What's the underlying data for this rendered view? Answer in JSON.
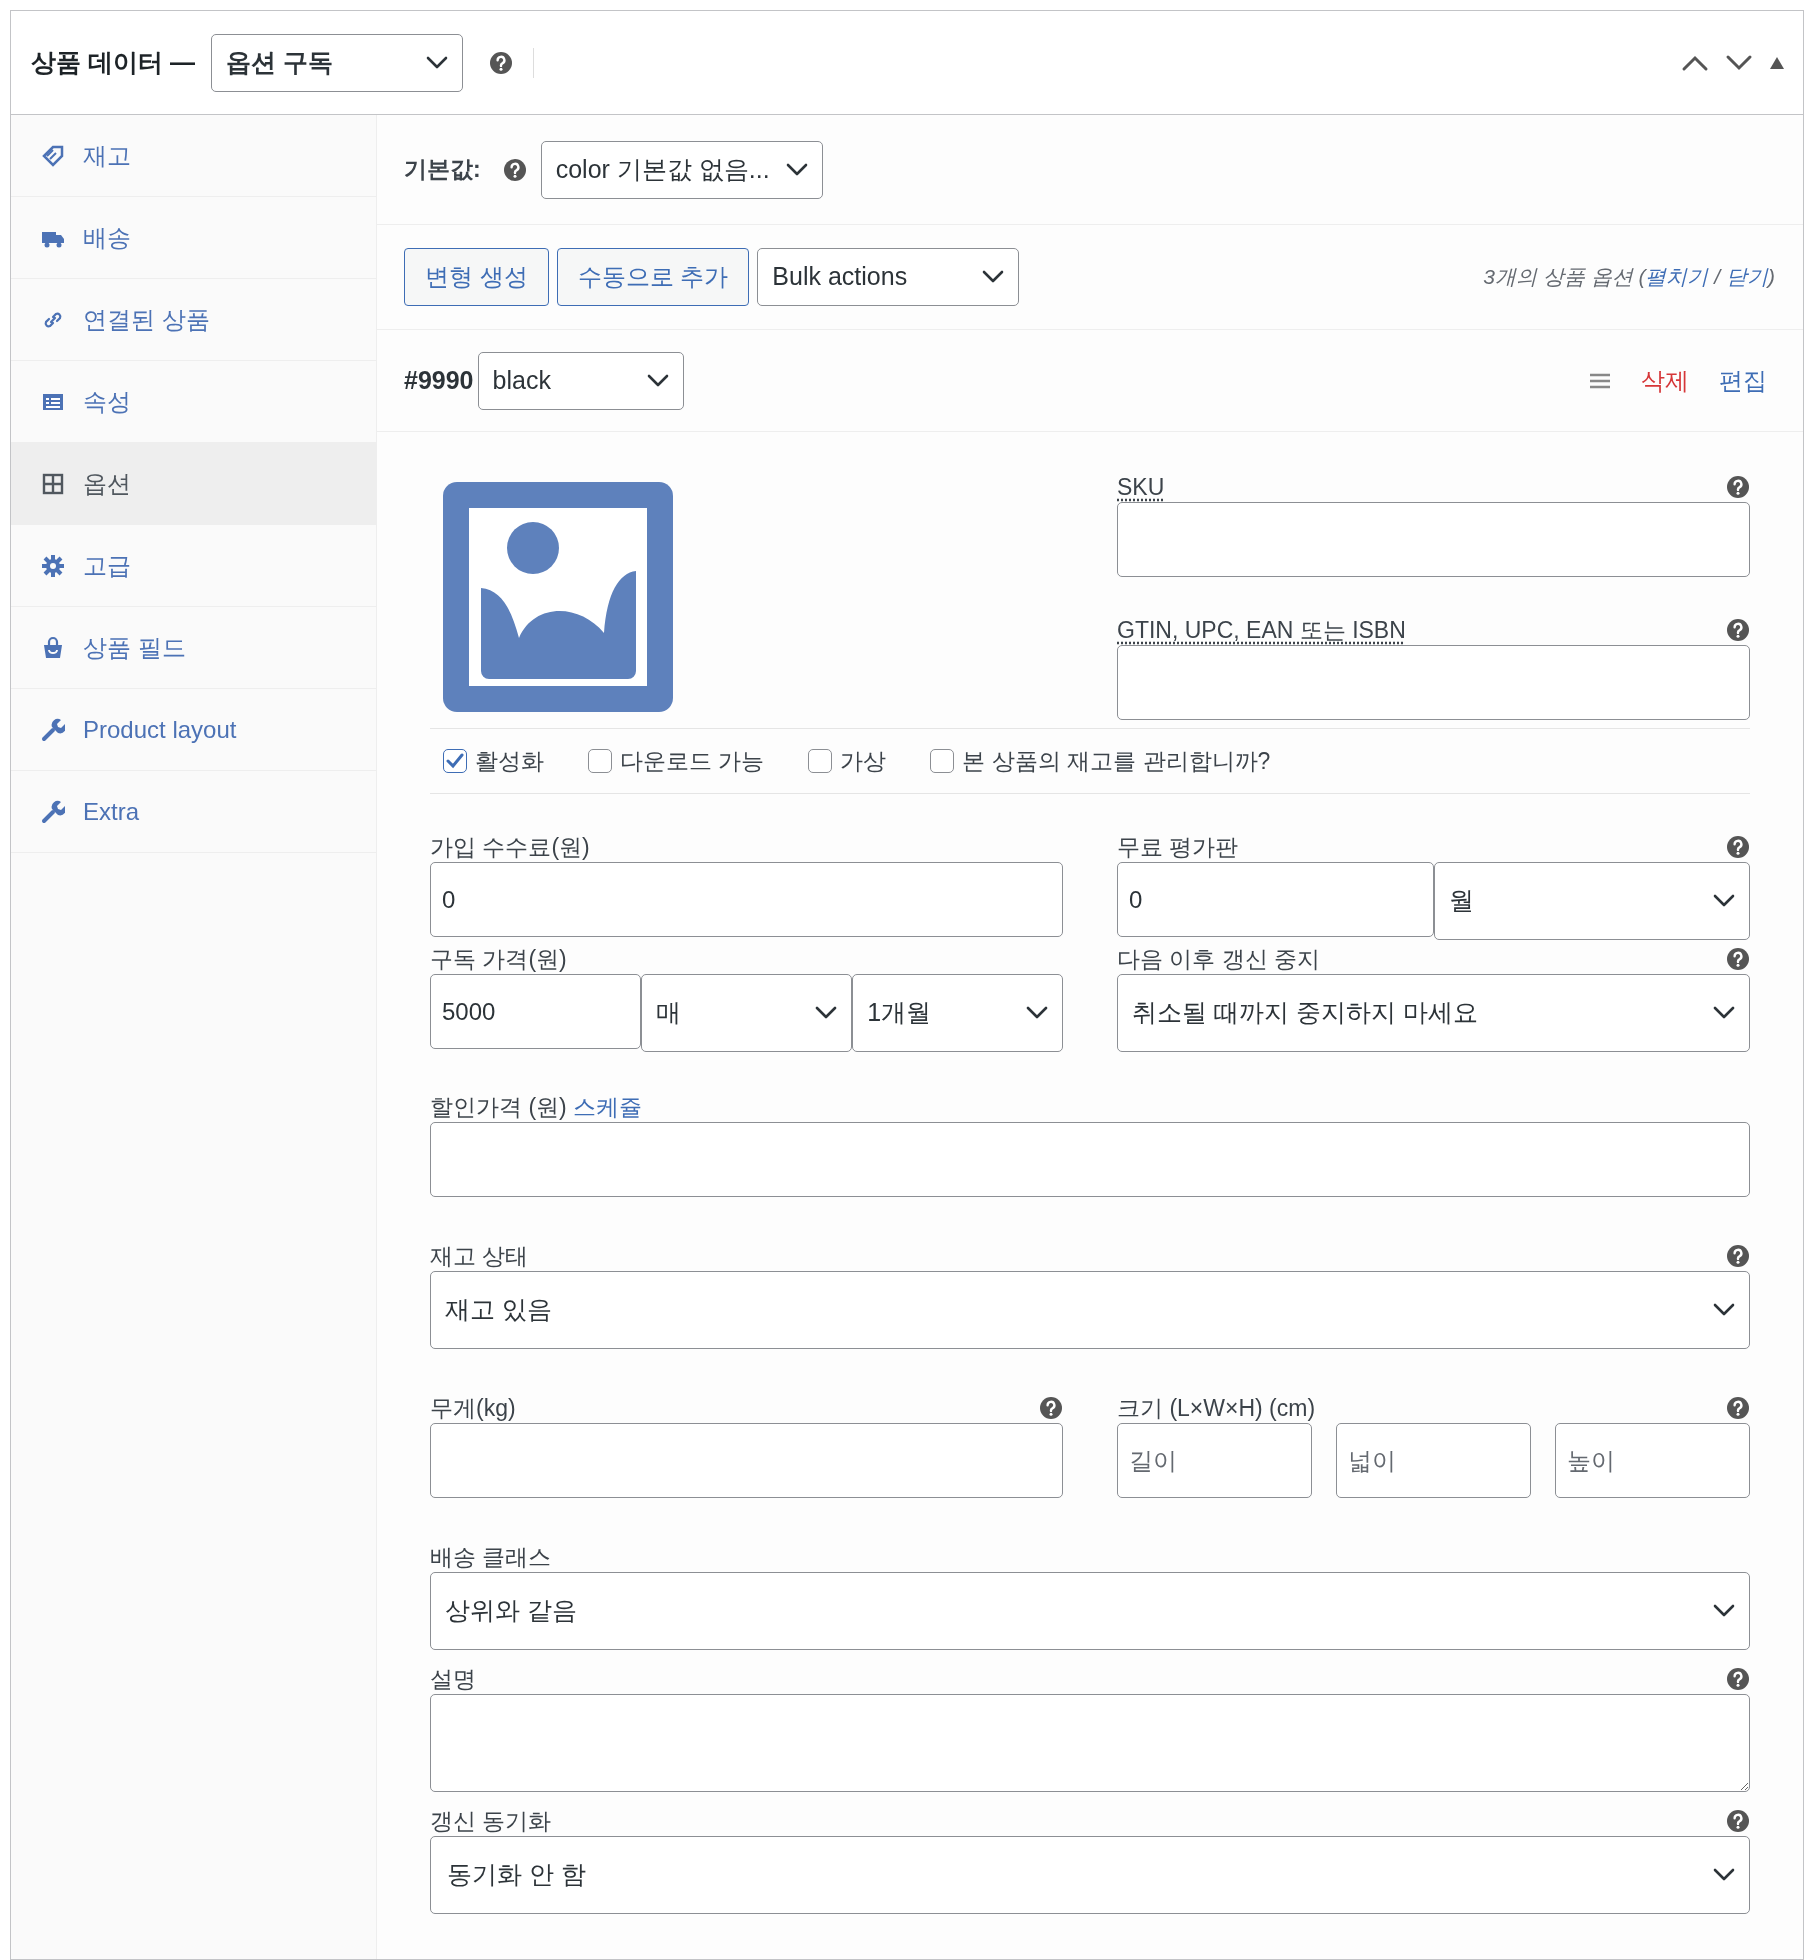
{
  "header": {
    "title": "상품 데이터 —",
    "product_type": "옵션 구독"
  },
  "sidebar": {
    "items": [
      {
        "label": "재고",
        "selected": false
      },
      {
        "label": "배송",
        "selected": false
      },
      {
        "label": "연결된 상품",
        "selected": false
      },
      {
        "label": "속성",
        "selected": false
      },
      {
        "label": "옵션",
        "selected": true
      },
      {
        "label": "고급",
        "selected": false
      },
      {
        "label": "상품 필드",
        "selected": false
      },
      {
        "label": "Product layout",
        "selected": false
      },
      {
        "label": "Extra",
        "selected": false
      }
    ]
  },
  "defaults": {
    "label": "기본값:",
    "value": "color 기본값 없음..."
  },
  "toolbar": {
    "buttons": [
      "변형 생성",
      "수동으로 추가"
    ],
    "bulk_actions": "Bulk actions",
    "summary": {
      "text": "3개의 상품 옵션 (",
      "links": [
        "펼치기",
        "닫기"
      ],
      "separator": " / ",
      "end": ")"
    }
  },
  "variation": {
    "id": "#9990",
    "attribute": "black",
    "remove": "삭제",
    "edit": "편집",
    "sku": {
      "label": "SKU",
      "help": true
    },
    "gtin": {
      "label": "GTIN, UPC, EAN 또는 ISBN",
      "help": true
    },
    "options": [
      {
        "label": "활성화",
        "checked": true
      },
      {
        "label": "다운로드 가능",
        "checked": false
      },
      {
        "label": "가상",
        "checked": false
      },
      {
        "label": "본 상품의 재고를 관리합니까?",
        "checked": false
      }
    ],
    "sign_up_fee": {
      "label": "가입 수수료(원)",
      "value": "0"
    },
    "free_trial": {
      "label": "무료 평가판",
      "value": "0",
      "period": "월",
      "help": true
    },
    "price": {
      "label": "구독 가격(원)",
      "value": "5000",
      "interval": "매",
      "period": "1개월"
    },
    "expire": {
      "label": "다음 이후 갱신 중지",
      "value": "취소될 때까지 중지하지 마세요",
      "help": true
    },
    "sale_price": {
      "label": "할인가격 (원)",
      "link": "스케쥴"
    },
    "stock_status": {
      "label": "재고 상태",
      "value": "재고 있음",
      "help": true
    },
    "weight": {
      "label": "무게(kg)",
      "help": true
    },
    "dimensions": {
      "label": "크기 (L×W×H) (cm)",
      "placeholders": [
        "길이",
        "넓이",
        "높이"
      ],
      "help": true
    },
    "shipping_class": {
      "label": "배송 클래스",
      "value": "상위와 같음"
    },
    "description": {
      "label": "설명",
      "help": true
    },
    "sync": {
      "label": "갱신 동기화",
      "value": "동기화 안 함",
      "help": true
    }
  }
}
